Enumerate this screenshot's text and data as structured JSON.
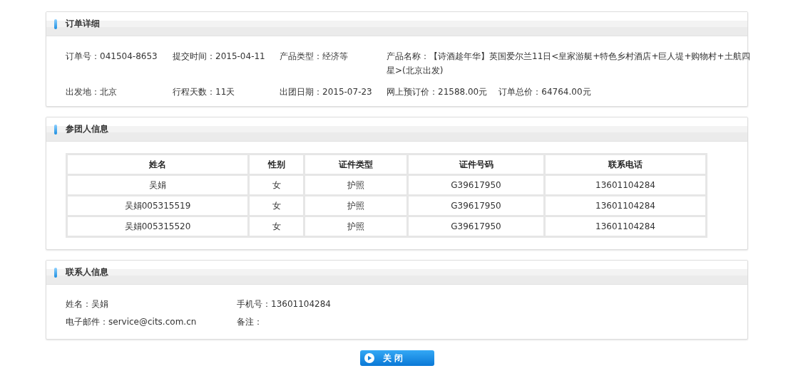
{
  "order_details": {
    "title": "订单详细",
    "rows": [
      [
        [
          "订单号：041504-8653"
        ],
        [
          "提交时间：2015-04-11"
        ],
        [
          "产品类型：经济等"
        ],
        [
          "产品名称：【诗酒趁年华】英国爱尔兰11日<皇家游艇+特色乡村酒店+巨人堤+购物村+土航四星>(北京出发)"
        ]
      ],
      [
        [
          "出发地：北京"
        ],
        [
          "行程天数：11天"
        ],
        [
          "出团日期：2015-07-23"
        ],
        [
          "网上预订价：21588.00元",
          "订单总价：64764.00元"
        ]
      ]
    ]
  },
  "travelers": {
    "title": "参团人信息",
    "columns": [
      "姓名",
      "性别",
      "证件类型",
      "证件号码",
      "联系电话"
    ],
    "rows": [
      [
        "吴娟",
        "女",
        "护照",
        "G39617950",
        "13601104284"
      ],
      [
        "吴娟005315519",
        "女",
        "护照",
        "G39617950",
        "13601104284"
      ],
      [
        "吴娟005315520",
        "女",
        "护照",
        "G39617950",
        "13601104284"
      ]
    ]
  },
  "contact": {
    "title": "联系人信息",
    "rows": [
      [
        "姓名：吴娟",
        "手机号：13601104284"
      ],
      [
        "电子邮件：service@cits.com.cn",
        "备注："
      ]
    ]
  },
  "close_button": {
    "label": "关 闭"
  }
}
